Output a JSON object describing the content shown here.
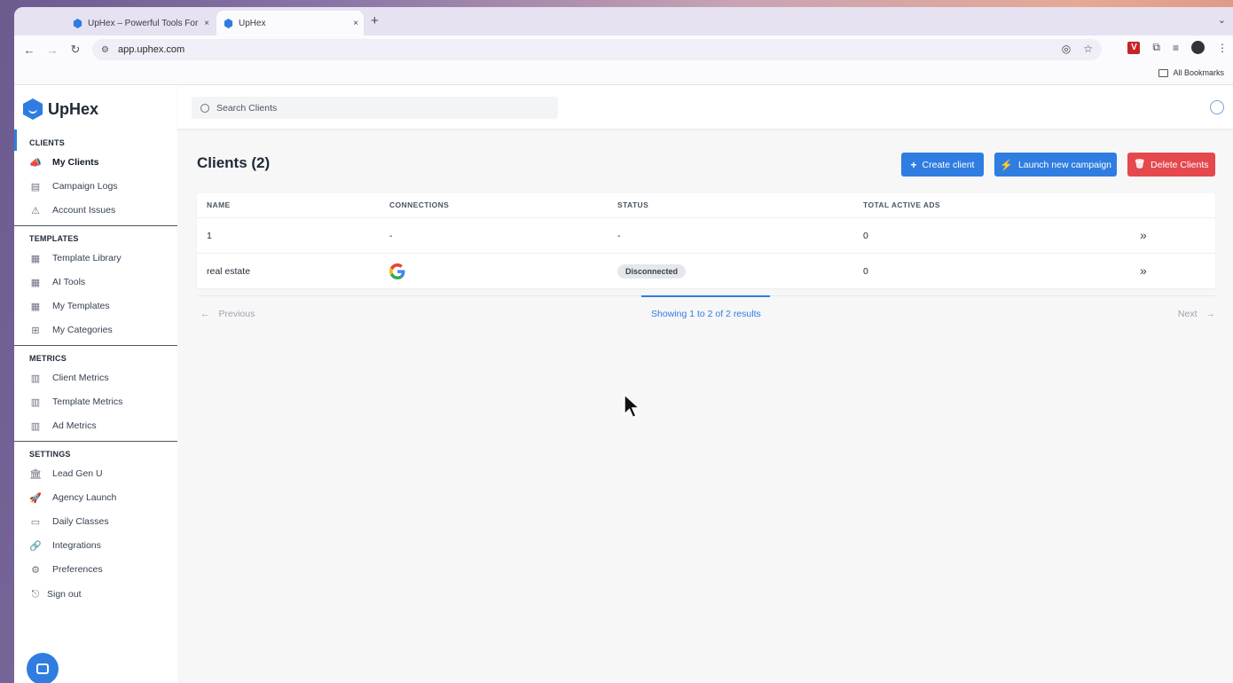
{
  "browser": {
    "tabs": [
      {
        "title": "UpHex – Powerful Tools For A",
        "close": "×"
      },
      {
        "title": "UpHex",
        "close": "×"
      }
    ],
    "new_tab": "+",
    "tab_menu": "⌄",
    "url": "app.uphex.com",
    "bookmarks_all": "All Bookmarks"
  },
  "app": {
    "brand": "UpHex",
    "search": {
      "placeholder": "Search Clients"
    },
    "sidebar": {
      "sections": [
        {
          "title": "CLIENTS",
          "items": [
            "My Clients",
            "Campaign Logs",
            "Account Issues"
          ]
        },
        {
          "title": "TEMPLATES",
          "items": [
            "Template Library",
            "AI Tools",
            "My Templates",
            "My Categories"
          ]
        },
        {
          "title": "METRICS",
          "items": [
            "Client Metrics",
            "Template Metrics",
            "Ad Metrics"
          ]
        },
        {
          "title": "SETTINGS",
          "items": [
            "Lead Gen U",
            "Agency Launch",
            "Daily Classes",
            "Integrations",
            "Preferences"
          ]
        }
      ],
      "sign_out": "Sign out"
    },
    "page": {
      "title": "Clients (2)",
      "buttons": {
        "create": "Create client",
        "launch": "Launch new campaign",
        "delete": "Delete Clients"
      },
      "table": {
        "columns": [
          "NAME",
          "CONNECTIONS",
          "STATUS",
          "TOTAL ACTIVE ADS"
        ],
        "rows": [
          {
            "name": "1",
            "connections": "-",
            "status": "-",
            "ads": "0",
            "action": "»"
          },
          {
            "name": "real estate",
            "connections": "google-icon",
            "status": "Disconnected",
            "ads": "0",
            "action": "»"
          }
        ]
      },
      "pagination": {
        "previous": "Previous",
        "next": "Next",
        "results": "Showing 1 to 2 of 2 results",
        "prev_arrow": "←",
        "next_arrow": "→"
      }
    },
    "colors": {
      "accent": "#2f7de0",
      "danger": "#e5484d"
    }
  }
}
